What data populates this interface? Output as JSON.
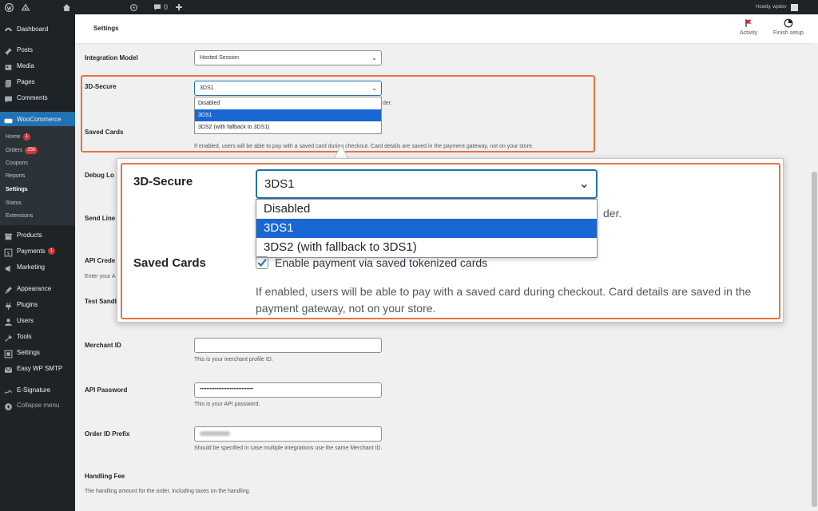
{
  "adminbar": {
    "howdy": "Howdy, wpdev",
    "comments_count": "0"
  },
  "sidebar": {
    "items": [
      {
        "label": "Dashboard",
        "icon": "dashboard-icon"
      },
      {
        "label": "Posts",
        "icon": "pin-icon"
      },
      {
        "label": "Media",
        "icon": "media-icon"
      },
      {
        "label": "Pages",
        "icon": "page-icon"
      },
      {
        "label": "Comments",
        "icon": "comment-icon"
      },
      {
        "label": "WooCommerce",
        "icon": "woo-icon"
      },
      {
        "label": "Products",
        "icon": "archive-icon"
      },
      {
        "label": "Payments",
        "icon": "dollar-icon",
        "badge": "1"
      },
      {
        "label": "Marketing",
        "icon": "megaphone-icon"
      },
      {
        "label": "Appearance",
        "icon": "brush-icon"
      },
      {
        "label": "Plugins",
        "icon": "plug-icon"
      },
      {
        "label": "Users",
        "icon": "user-icon"
      },
      {
        "label": "Tools",
        "icon": "wrench-icon"
      },
      {
        "label": "Settings",
        "icon": "settings-icon"
      },
      {
        "label": "Easy WP SMTP",
        "icon": "mail-icon"
      },
      {
        "label": "E-Signature",
        "icon": "signature-icon"
      },
      {
        "label": "Collapse menu",
        "icon": "collapse-icon"
      }
    ],
    "woo_sub": [
      {
        "label": "Home",
        "badge": "1"
      },
      {
        "label": "Orders",
        "badge": "250"
      },
      {
        "label": "Coupons"
      },
      {
        "label": "Reports"
      },
      {
        "label": "Settings"
      },
      {
        "label": "Status"
      },
      {
        "label": "Extensions"
      }
    ]
  },
  "header": {
    "title": "Settings",
    "activity": "Activity",
    "finish_setup": "Finish setup"
  },
  "form": {
    "integration_model": {
      "label": "Integration Model",
      "value": "Hosted Session"
    },
    "three_ds": {
      "label": "3D-Secure",
      "value": "3DS1",
      "tail": "der.",
      "options": [
        "Disabled",
        "3DS1",
        "3DS2 (with fallback to 3DS1)"
      ]
    },
    "saved_cards": {
      "label": "Saved Cards",
      "checkbox_label": "Enable payment via saved tokenized cards",
      "description": "If enabled, users will be able to pay with a saved card during checkout. Card details are saved in the payment gateway, not on your store."
    },
    "debug_log": {
      "label": "Debug Lo"
    },
    "send_line": {
      "label": "Send Line I"
    },
    "api_creds": {
      "label": "API Crede",
      "desc": "Enter your A"
    },
    "test_sandbox": {
      "label": "Test Sandb"
    },
    "merchant_id": {
      "label": "Merchant ID",
      "value": "",
      "desc": "This is your merchant profile ID."
    },
    "api_password": {
      "label": "API Password",
      "value": "••••••••••••••••••••••••••••••••",
      "desc": "This is your API password."
    },
    "order_prefix": {
      "label": "Order ID Prefix",
      "value": "",
      "desc": "Should be specified in case multiple integrations use the same Merchant ID."
    },
    "handling_fee": {
      "label": "Handling Fee",
      "desc": "The handling amount for the order, including taxes on the handling."
    }
  },
  "colors": {
    "accent": "#2271b1",
    "highlight": "#e8733a",
    "selected": "#1967d2"
  }
}
